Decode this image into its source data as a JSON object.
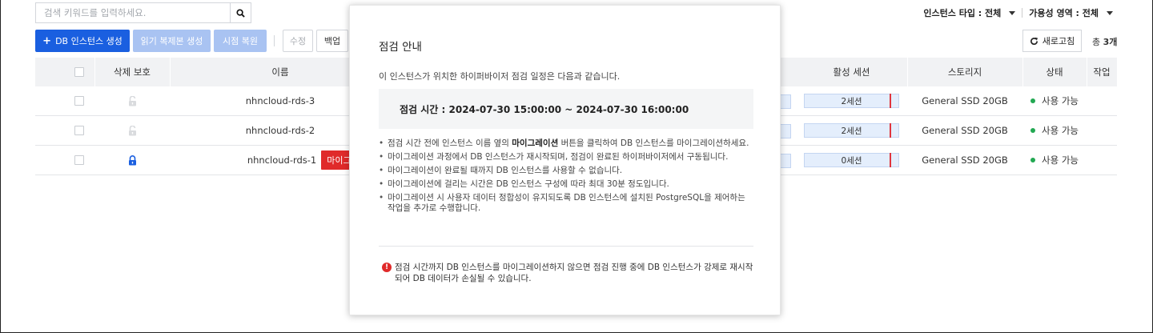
{
  "search": {
    "placeholder": "검색 키워드를 입력하세요."
  },
  "filters": {
    "instance_type": "인스턴스 타입 : 전체",
    "availability_zone": "가용성 영역 : 전체"
  },
  "toolbar": {
    "create_db": "DB 인스턴스 생성",
    "create_replica": "읽기 복제본 생성",
    "point_in_time_restore": "시점 복원",
    "modify": "수정",
    "backup": "백업",
    "refresh": "새로고침",
    "total_prefix": "총",
    "total_count": "3개"
  },
  "table": {
    "headers": {
      "delete_protection": "삭제 보호",
      "name": "이름",
      "active_sessions": "활성 세션",
      "storage": "스토리지",
      "status": "상태",
      "actions": "작업"
    },
    "rows": [
      {
        "name": "nhncloud-rds-3",
        "locked": false,
        "badge": "",
        "sessions": "2세션",
        "storage": "General SSD 20GB",
        "status": "사용 가능"
      },
      {
        "name": "nhncloud-rds-2",
        "locked": false,
        "badge": "",
        "sessions": "2세션",
        "storage": "General SSD 20GB",
        "status": "사용 가능"
      },
      {
        "name": "nhncloud-rds-1",
        "locked": true,
        "badge": "마이그레이션",
        "sessions": "0세션",
        "storage": "General SSD 20GB",
        "status": "사용 가능"
      }
    ]
  },
  "modal": {
    "title": "점검 안내",
    "intro": "이 인스턴스가 위치한 하이퍼바이저 점검 일정은 다음과 같습니다.",
    "schedule": "점검 시간 : 2024-07-30 15:00:00 ~ 2024-07-30 16:00:00",
    "bullets": {
      "b1_pre": "점검 시간 전에 인스턴스 이름 옆의 ",
      "b1_bold": "마이그레이션",
      "b1_post": " 버튼을 클릭하여 DB 인스턴스를 마이그레이션하세요.",
      "b2": "마이그레이션 과정에서 DB 인스턴스가 재시작되며, 점검이 완료된 하이퍼바이저에서 구동됩니다.",
      "b3": "마이그레이션이 완료될 때까지 DB 인스턴스를 사용할 수 없습니다.",
      "b4": "마이그레이션에 걸리는 시간은 DB 인스턴스 구성에 따라 최대 30분 정도입니다.",
      "b5": "마이그레이션 시 사용자 데이터 정합성이 유지되도록 DB 인스턴스에 설치된 PostgreSQL을 제어하는 작업을 추가로 수행합니다."
    },
    "warning": "점검 시간까지 DB 인스턴스를 마이그레이션하지 않으면 점검 진행 중에 DB 인스턴스가 강제로 재시작되어 DB 데이터가 손실될 수 있습니다."
  },
  "colors": {
    "primary": "#1a5fe0",
    "danger": "#e02a2a",
    "success": "#22a852"
  }
}
